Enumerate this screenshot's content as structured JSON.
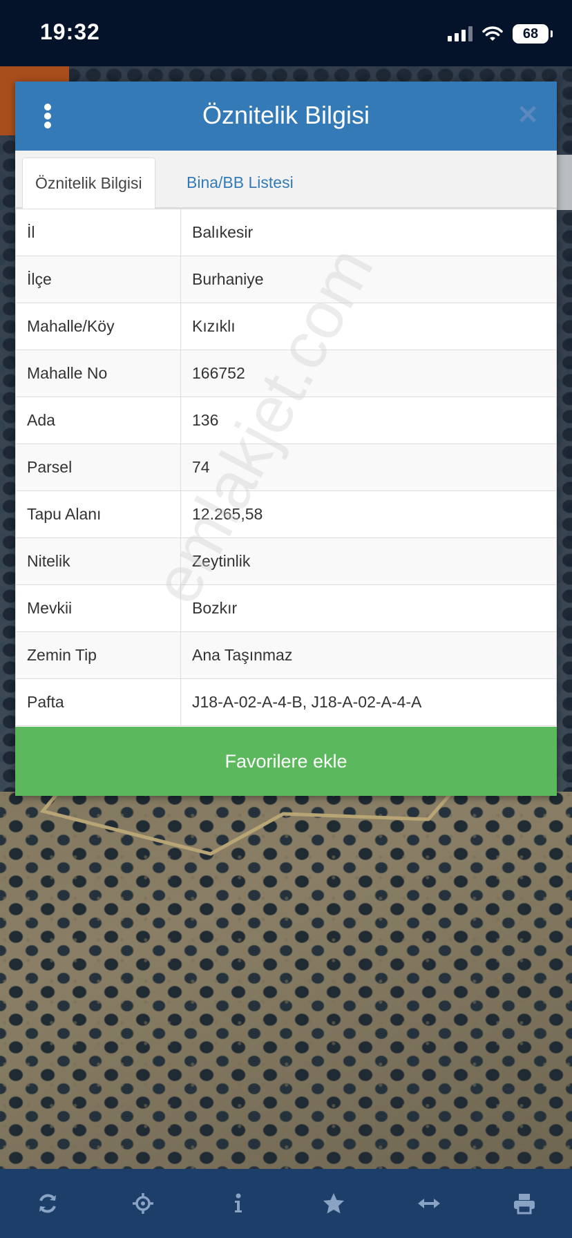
{
  "status_bar": {
    "time": "19:32",
    "battery": "68"
  },
  "dialog": {
    "title": "Öznitelik Bilgisi",
    "tabs": [
      {
        "label": "Öznitelik Bilgisi",
        "active": true
      },
      {
        "label": "Bina/BB Listesi",
        "active": false
      }
    ],
    "rows": [
      {
        "key": "İl",
        "value": "Balıkesir"
      },
      {
        "key": "İlçe",
        "value": "Burhaniye"
      },
      {
        "key": "Mahalle/Köy",
        "value": "Kızıklı"
      },
      {
        "key": "Mahalle No",
        "value": "166752"
      },
      {
        "key": "Ada",
        "value": "136"
      },
      {
        "key": "Parsel",
        "value": "74"
      },
      {
        "key": "Tapu Alanı",
        "value": "12.265,58"
      },
      {
        "key": "Nitelik",
        "value": "Zeytinlik"
      },
      {
        "key": "Mevkii",
        "value": "Bozkır"
      },
      {
        "key": "Zemin Tip",
        "value": "Ana Taşınmaz"
      },
      {
        "key": "Pafta",
        "value": "J18-A-02-A-4-B, J18-A-02-A-4-A"
      }
    ],
    "favorite_button": "Favorilere ekle"
  },
  "watermark": "emlakjet.com",
  "toolbar": {
    "icons": [
      "refresh-icon",
      "locate-icon",
      "info-icon",
      "star-icon",
      "measure-icon",
      "print-icon"
    ]
  },
  "colors": {
    "header": "#337ab7",
    "favorite": "#5cb85c",
    "toolbar": "#1d3e68",
    "status_bar": "#04132a"
  }
}
